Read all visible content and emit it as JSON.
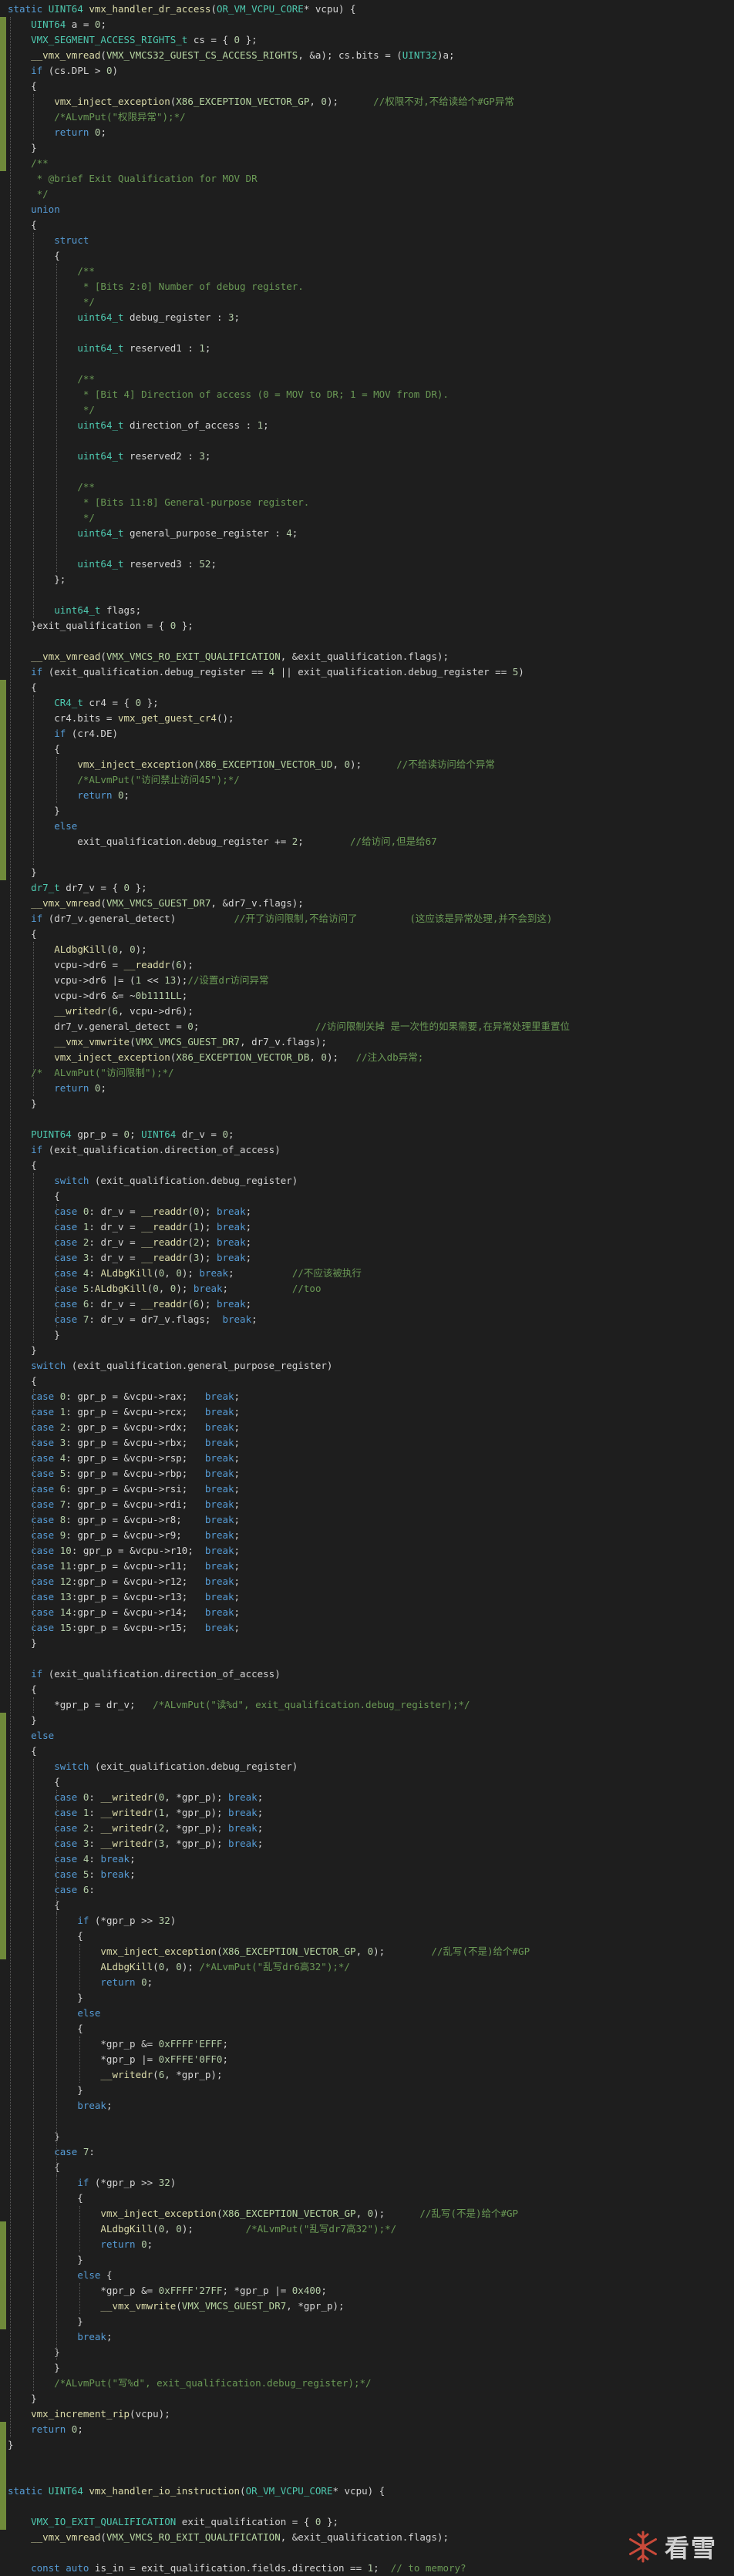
{
  "colors": {
    "background": "#1e1e1e",
    "text": "#d4d4d4",
    "keyword": "#569cd6",
    "type": "#4ec9b0",
    "function": "#dcdcaa",
    "comment": "#6a9955",
    "macro": "#b8d7a3",
    "number": "#b5cea8",
    "string": "#ce9178",
    "gutter_modified": "#6f8a3a"
  },
  "watermark": {
    "icon": "snowflake-icon",
    "text": "看雪"
  },
  "code": [
    "static UINT64 vmx_handler_dr_access(OR_VM_VCPU_CORE* vcpu) {",
    "    UINT64 a = 0;",
    "    VMX_SEGMENT_ACCESS_RIGHTS_t cs = { 0 };",
    "    __vmx_vmread(VMX_VMCS32_GUEST_CS_ACCESS_RIGHTS, &a); cs.bits = (UINT32)a;",
    "    if (cs.DPL > 0)",
    "    {",
    "        vmx_inject_exception(X86_EXCEPTION_VECTOR_GP, 0);      //权限不对,不给读给个#GP异常",
    "        /*ALvmPut(\"权限异常\");*/",
    "        return 0;",
    "    }",
    "    /**",
    "     * @brief Exit Qualification for MOV DR",
    "     */",
    "    union",
    "    {",
    "        struct",
    "        {",
    "            /**",
    "             * [Bits 2:0] Number of debug register.",
    "             */",
    "            uint64_t debug_register : 3;",
    "",
    "            uint64_t reserved1 : 1;",
    "",
    "            /**",
    "             * [Bit 4] Direction of access (0 = MOV to DR; 1 = MOV from DR).",
    "             */",
    "            uint64_t direction_of_access : 1;",
    "",
    "            uint64_t reserved2 : 3;",
    "",
    "            /**",
    "             * [Bits 11:8] General-purpose register.",
    "             */",
    "            uint64_t general_purpose_register : 4;",
    "",
    "            uint64_t reserved3 : 52;",
    "        };",
    "",
    "        uint64_t flags;",
    "    }exit_qualification = { 0 };",
    "",
    "    __vmx_vmread(VMX_VMCS_RO_EXIT_QUALIFICATION, &exit_qualification.flags);",
    "    if (exit_qualification.debug_register == 4 || exit_qualification.debug_register == 5)",
    "    {",
    "        CR4_t cr4 = { 0 };",
    "        cr4.bits = vmx_get_guest_cr4();",
    "        if (cr4.DE)",
    "        {",
    "            vmx_inject_exception(X86_EXCEPTION_VECTOR_UD, 0);      //不给读访问给个异常",
    "            /*ALvmPut(\"访问禁止访问45\");*/",
    "            return 0;",
    "        }",
    "        else",
    "            exit_qualification.debug_register += 2;        //给访问,但是给67",
    "",
    "    }",
    "    dr7_t dr7_v = { 0 };",
    "    __vmx_vmread(VMX_VMCS_GUEST_DR7, &dr7_v.flags);",
    "    if (dr7_v.general_detect)          //开了访问限制,不给访问了         (这应该是异常处理,并不会到这)",
    "    {",
    "        ALdbgKill(0, 0);",
    "        vcpu->dr6 = __readdr(6);",
    "        vcpu->dr6 |= (1 << 13);//设置dr访问异常",
    "        vcpu->dr6 &= ~0b1111LL;",
    "        __writedr(6, vcpu->dr6);",
    "        dr7_v.general_detect = 0;                    //访问限制关掉 是一次性的如果需要,在异常处理里重置位",
    "        __vmx_vmwrite(VMX_VMCS_GUEST_DR7, dr7_v.flags);",
    "        vmx_inject_exception(X86_EXCEPTION_VECTOR_DB, 0);   //注入db异常;",
    "    /*  ALvmPut(\"访问限制\");*/",
    "        return 0;",
    "    }",
    "",
    "    PUINT64 gpr_p = 0; UINT64 dr_v = 0;",
    "    if (exit_qualification.direction_of_access)",
    "    {",
    "        switch (exit_qualification.debug_register)",
    "        {",
    "        case 0: dr_v = __readdr(0); break;",
    "        case 1: dr_v = __readdr(1); break;",
    "        case 2: dr_v = __readdr(2); break;",
    "        case 3: dr_v = __readdr(3); break;",
    "        case 4: ALdbgKill(0, 0); break;          //不应该被执行",
    "        case 5:ALdbgKill(0, 0); break;           //too",
    "        case 6: dr_v = __readdr(6); break;",
    "        case 7: dr_v = dr7_v.flags;  break;",
    "        }",
    "    }",
    "    switch (exit_qualification.general_purpose_register)",
    "    {",
    "    case 0: gpr_p = &vcpu->rax;   break;",
    "    case 1: gpr_p = &vcpu->rcx;   break;",
    "    case 2: gpr_p = &vcpu->rdx;   break;",
    "    case 3: gpr_p = &vcpu->rbx;   break;",
    "    case 4: gpr_p = &vcpu->rsp;   break;",
    "    case 5: gpr_p = &vcpu->rbp;   break;",
    "    case 6: gpr_p = &vcpu->rsi;   break;",
    "    case 7: gpr_p = &vcpu->rdi;   break;",
    "    case 8: gpr_p = &vcpu->r8;    break;",
    "    case 9: gpr_p = &vcpu->r9;    break;",
    "    case 10: gpr_p = &vcpu->r10;  break;",
    "    case 11:gpr_p = &vcpu->r11;   break;",
    "    case 12:gpr_p = &vcpu->r12;   break;",
    "    case 13:gpr_p = &vcpu->r13;   break;",
    "    case 14:gpr_p = &vcpu->r14;   break;",
    "    case 15:gpr_p = &vcpu->r15;   break;",
    "    }",
    "",
    "    if (exit_qualification.direction_of_access)",
    "    {",
    "        *gpr_p = dr_v;   /*ALvmPut(\"读%d\", exit_qualification.debug_register);*/",
    "    }",
    "    else",
    "    {",
    "        switch (exit_qualification.debug_register)",
    "        {",
    "        case 0: __writedr(0, *gpr_p); break;",
    "        case 1: __writedr(1, *gpr_p); break;",
    "        case 2: __writedr(2, *gpr_p); break;",
    "        case 3: __writedr(3, *gpr_p); break;",
    "        case 4: break;",
    "        case 5: break;",
    "        case 6:",
    "        {",
    "            if (*gpr_p >> 32)",
    "            {",
    "                vmx_inject_exception(X86_EXCEPTION_VECTOR_GP, 0);        //乱写(不是)给个#GP",
    "                ALdbgKill(0, 0); /*ALvmPut(\"乱写dr6高32\");*/",
    "                return 0;",
    "            }",
    "            else",
    "            {",
    "                *gpr_p &= 0xFFFF'EFFF;",
    "                *gpr_p |= 0xFFFE'0FF0;",
    "                __writedr(6, *gpr_p);",
    "            }",
    "            break;",
    "",
    "        }",
    "        case 7:",
    "        {",
    "            if (*gpr_p >> 32)",
    "            {",
    "                vmx_inject_exception(X86_EXCEPTION_VECTOR_GP, 0);      //乱写(不是)给个#GP",
    "                ALdbgKill(0, 0);         /*ALvmPut(\"乱写dr7高32\");*/",
    "                return 0;",
    "            }",
    "            else {",
    "                *gpr_p &= 0xFFFF'27FF; *gpr_p |= 0x400;",
    "                __vmx_vmwrite(VMX_VMCS_GUEST_DR7, *gpr_p);",
    "            }",
    "            break;",
    "        }",
    "        }",
    "        /*ALvmPut(\"写%d\", exit_qualification.debug_register);*/",
    "    }",
    "    vmx_increment_rip(vcpu);",
    "    return 0;",
    "}",
    "",
    "",
    "static UINT64 vmx_handler_io_instruction(OR_VM_VCPU_CORE* vcpu) {",
    "",
    "    VMX_IO_EXIT_QUALIFICATION exit_qualification = { 0 };",
    "    __vmx_vmread(VMX_VMCS_RO_EXIT_QUALIFICATION, &exit_qualification.flags);",
    "",
    "    const auto is_in = exit_qualification.fields.direction == 1;  // to memory?"
  ]
}
